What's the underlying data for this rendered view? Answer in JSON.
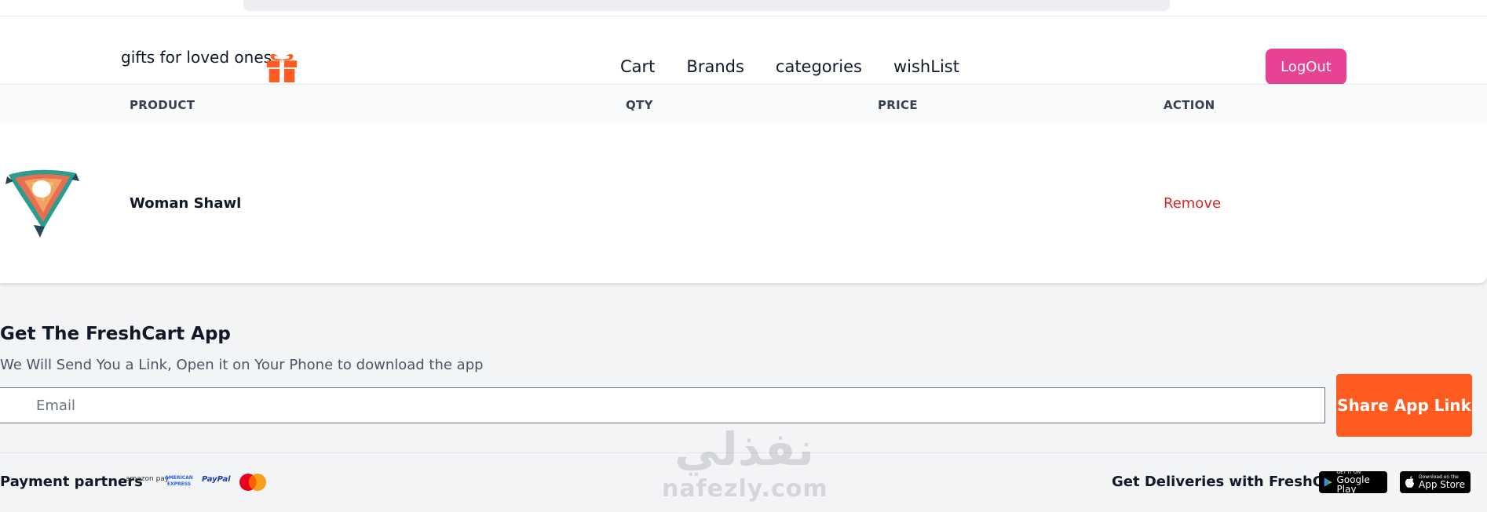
{
  "nav": {
    "brand": "gifts for loved ones",
    "links": [
      "Cart",
      "Brands",
      "categories",
      "wishList"
    ],
    "logout": "LogOut"
  },
  "table": {
    "headers": [
      "PRODUCT",
      "QTY",
      "PRICE",
      "ACTION"
    ],
    "rows": [
      {
        "name": "Woman Shawl",
        "qty": "",
        "price": "",
        "action": "Remove"
      }
    ]
  },
  "app": {
    "title": "Get The FreshCart App",
    "subtitle": "We Will Send You a Link, Open it on Your Phone to download the app",
    "email_placeholder": "Email",
    "share": "Share App Link"
  },
  "footer": {
    "payment_label": "Payment partners",
    "payment_logos": [
      "amazon pay",
      "AMERICAN EXPRESS",
      "PayPal",
      "MasterCard"
    ],
    "deliveries_label": "Get Deliveries with FreshCart",
    "google_play": {
      "small": "GET IT ON",
      "big": "Google Play"
    },
    "app_store": {
      "small": "Download on the",
      "big": "App Store"
    }
  },
  "watermark": {
    "arabic": "نفذلي",
    "latin": "nafezly.com"
  },
  "colors": {
    "logout_bg": "#e84393",
    "share_bg": "#ff5a1f",
    "remove_text": "#dc2626",
    "gift_icon": "#ff5a1f"
  }
}
